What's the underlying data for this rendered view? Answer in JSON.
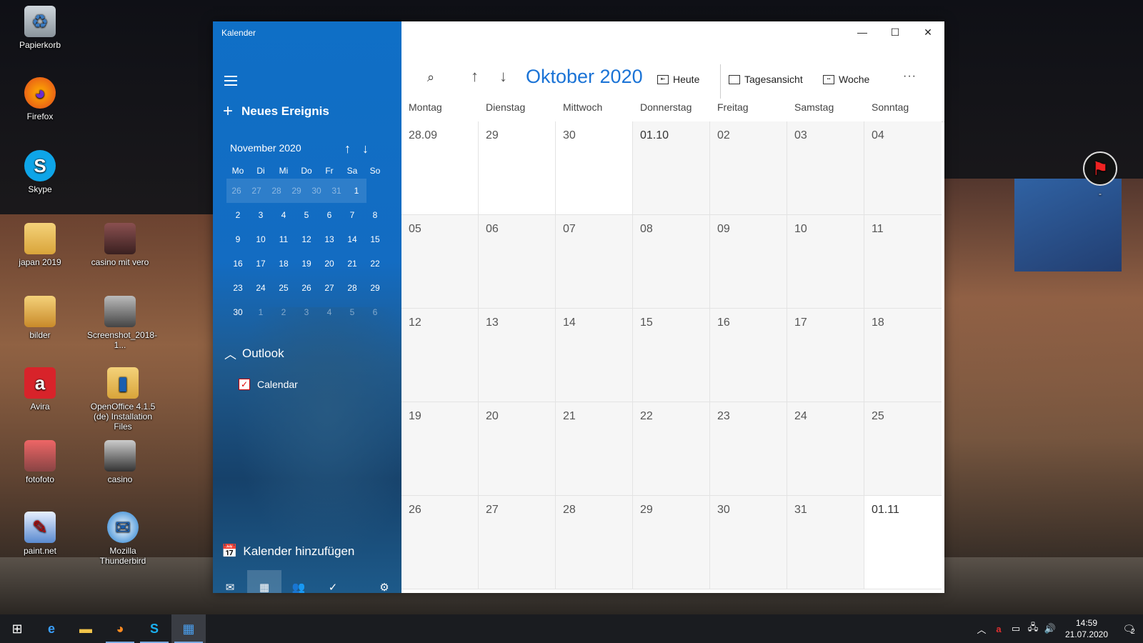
{
  "desktop": {
    "icons": [
      {
        "label": "Papierkorb"
      },
      {
        "label": "Firefox"
      },
      {
        "label": "Skype"
      },
      {
        "label": "japan 2019"
      },
      {
        "label": "casino mit vero"
      },
      {
        "label": "bilder"
      },
      {
        "label": "Screenshot_2018-1..."
      },
      {
        "label": "Avira"
      },
      {
        "label": "OpenOffice 4.1.5 (de) Installation Files"
      },
      {
        "label": "fotofoto"
      },
      {
        "label": "casino"
      },
      {
        "label": "paint.net"
      },
      {
        "label": "Mozilla Thunderbird"
      },
      {
        "label": "-"
      }
    ]
  },
  "app": {
    "title": "Kalender",
    "new_event": "Neues Ereignis",
    "mini_calendar": {
      "month_label": "November 2020",
      "weekdays": [
        "Mo",
        "Di",
        "Mi",
        "Do",
        "Fr",
        "Sa",
        "So"
      ],
      "weeks": [
        [
          "26",
          "27",
          "28",
          "29",
          "30",
          "31",
          "1"
        ],
        [
          "2",
          "3",
          "4",
          "5",
          "6",
          "7",
          "8"
        ],
        [
          "9",
          "10",
          "11",
          "12",
          "13",
          "14",
          "15"
        ],
        [
          "16",
          "17",
          "18",
          "19",
          "20",
          "21",
          "22"
        ],
        [
          "23",
          "24",
          "25",
          "26",
          "27",
          "28",
          "29"
        ],
        [
          "30",
          "1",
          "2",
          "3",
          "4",
          "5",
          "6"
        ]
      ]
    },
    "accounts": {
      "group_label": "Outlook",
      "calendars": [
        {
          "label": "Calendar",
          "checked": true,
          "color": "#d32f2f"
        }
      ]
    },
    "add_calendar": "Kalender hinzufügen",
    "toolbar": {
      "month_title": "Oktober 2020",
      "today": "Heute",
      "day_view": "Tagesansicht",
      "week": "Woche",
      "more": "···"
    },
    "weekdays": [
      "Montag",
      "Dienstag",
      "Mittwoch",
      "Donnerstag",
      "Freitag",
      "Samstag",
      "Sonntag"
    ],
    "month_grid": [
      [
        "28.09",
        "29",
        "30",
        "01.10",
        "02",
        "03",
        "04"
      ],
      [
        "05",
        "06",
        "07",
        "08",
        "09",
        "10",
        "11"
      ],
      [
        "12",
        "13",
        "14",
        "15",
        "16",
        "17",
        "18"
      ],
      [
        "19",
        "20",
        "21",
        "22",
        "23",
        "24",
        "25"
      ],
      [
        "26",
        "27",
        "28",
        "29",
        "30",
        "31",
        "01.11"
      ]
    ],
    "accent_color": "#1a73d6"
  },
  "taskbar": {
    "clock_time": "14:59",
    "clock_date": "21.07.2020",
    "notification_count": "2"
  }
}
